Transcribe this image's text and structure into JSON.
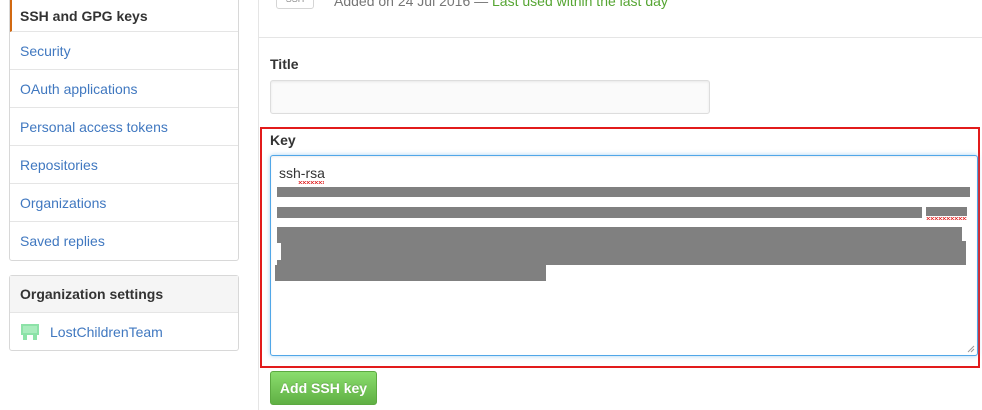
{
  "sidebar": {
    "items": [
      {
        "label": "SSH and GPG keys",
        "selected": true
      },
      {
        "label": "Security"
      },
      {
        "label": "OAuth applications"
      },
      {
        "label": "Personal access tokens"
      },
      {
        "label": "Repositories"
      },
      {
        "label": "Organizations"
      },
      {
        "label": "Saved replies"
      }
    ]
  },
  "org_settings": {
    "heading": "Organization settings",
    "items": [
      {
        "label": "LostChildrenTeam",
        "icon": "org-avatar-icon",
        "color": "#8de2a8"
      }
    ]
  },
  "existing_key": {
    "badge": "SSH",
    "added": "Added on 24 Jul 2016 —",
    "last_used": "Last used within the last day"
  },
  "form": {
    "title_label": "Title",
    "title_value": "",
    "key_label": "Key",
    "key_value_visible": "ssh-rsa",
    "key_redacted": true,
    "submit_label": "Add SSH key"
  },
  "colors": {
    "link": "#4078c0",
    "selected_accent": "#d26911",
    "last_used": "#55a532",
    "highlight": "#e21b1b",
    "button": "#60b044",
    "redaction": "#808080"
  }
}
